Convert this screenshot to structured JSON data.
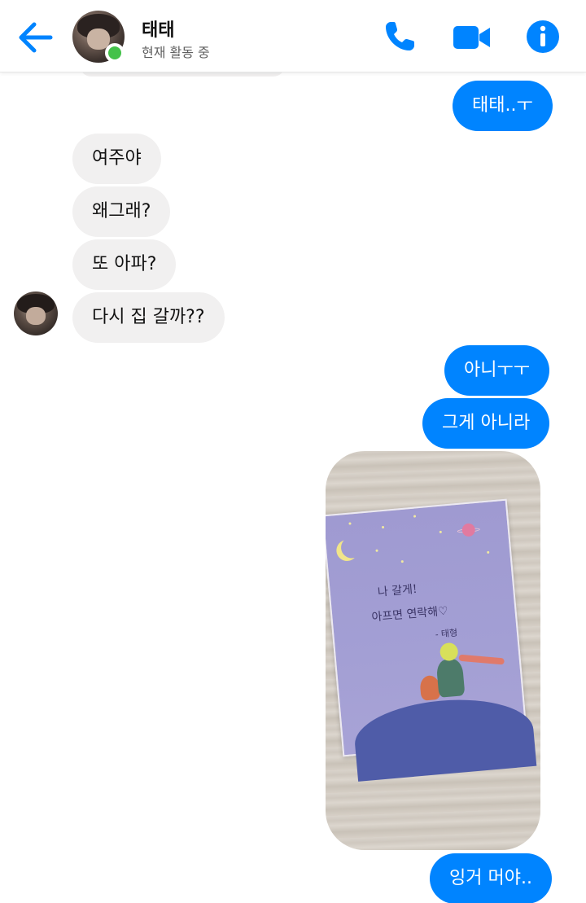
{
  "header": {
    "contact_name": "태태",
    "status": "현재 활동 중",
    "back_icon": "arrow-left-icon",
    "call_icon": "phone-icon",
    "video_icon": "video-camera-icon",
    "info_icon": "info-icon",
    "online": true,
    "accent_color": "#0084ff",
    "online_color": "#44c24a"
  },
  "messages": [
    {
      "from": "me",
      "text": "태태..ㅜ"
    },
    {
      "from": "contact",
      "text": "여주야"
    },
    {
      "from": "contact",
      "text": "왜그래?"
    },
    {
      "from": "contact",
      "text": "또 아파?"
    },
    {
      "from": "contact",
      "text": "다시 집 갈까??"
    },
    {
      "from": "me",
      "text": "아니ㅜㅜ"
    },
    {
      "from": "me",
      "text": "그게 아니라"
    },
    {
      "from": "me",
      "type": "photo"
    },
    {
      "from": "me",
      "text": "잉거 머야.."
    }
  ],
  "photo_card": {
    "line1": "나 갈게!",
    "line2": "아프면 연락해♡",
    "line3": "- 태형"
  },
  "colors": {
    "sent_bubble": "#0084ff",
    "received_bubble": "#f1f0f0"
  }
}
